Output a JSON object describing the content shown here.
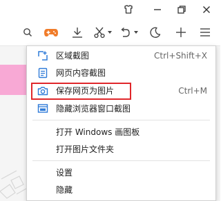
{
  "window": {
    "buttons": [
      {
        "name": "skin-icon"
      },
      {
        "name": "minimize-icon"
      },
      {
        "name": "restore-icon"
      },
      {
        "name": "close-icon"
      }
    ]
  },
  "toolbar": {
    "icons": [
      "search-icon",
      "game-controller-icon",
      "download-icon",
      "scissors-icon",
      "dropdown-arrow-icon",
      "undo-icon",
      "dropdown-arrow-icon",
      "night-mode-icon",
      "add-icon",
      "menu-icon"
    ]
  },
  "colors": {
    "accent_blue": "#2f7bd8",
    "highlight_red": "#e0262a",
    "game_orange": "#f07c2a",
    "pink": "#f8a9d5"
  },
  "menu": {
    "items": [
      {
        "label": "区域截图",
        "shortcut": "Ctrl+Shift+X",
        "icon": "area-screenshot-icon"
      },
      {
        "label": "网页内容截图",
        "shortcut": "",
        "icon": "webpage-content-icon"
      },
      {
        "label": "保存网页为图片",
        "shortcut": "Ctrl+M",
        "icon": "camera-icon"
      },
      {
        "label": "隐藏浏览器窗口截图",
        "shortcut": "",
        "icon": "hide-window-screenshot-icon"
      },
      {
        "label": "打开 Windows 画图板",
        "shortcut": ""
      },
      {
        "label": "打开图片文件夹",
        "shortcut": ""
      },
      {
        "label": "设置",
        "shortcut": ""
      },
      {
        "label": "隐藏",
        "shortcut": ""
      }
    ]
  }
}
